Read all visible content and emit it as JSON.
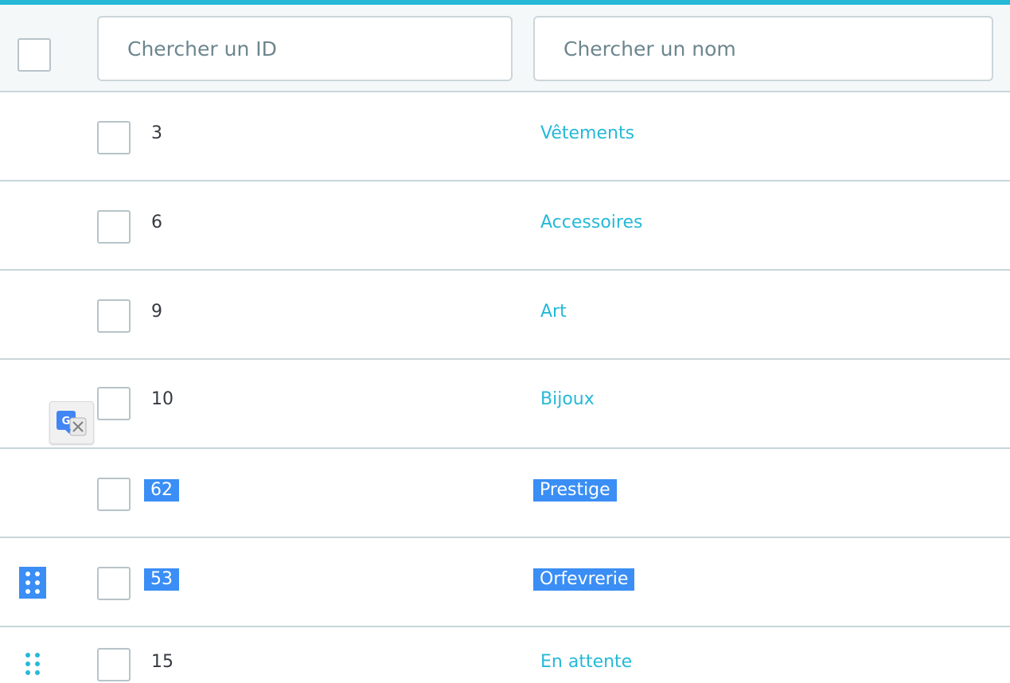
{
  "filters": {
    "id_placeholder": "Chercher un ID",
    "name_placeholder": "Chercher un nom"
  },
  "rows": [
    {
      "id": "3",
      "name": "Vêtements"
    },
    {
      "id": "6",
      "name": "Accessoires"
    },
    {
      "id": "9",
      "name": "Art"
    },
    {
      "id": "10",
      "name": "Bijoux"
    },
    {
      "id": "62",
      "name": "Prestige"
    },
    {
      "id": "53",
      "name": "Orfevrerie"
    },
    {
      "id": "15",
      "name": "En attente"
    }
  ],
  "colors": {
    "accent": "#25b9d7",
    "selection": "#3a8ef5",
    "text": "#363a41"
  },
  "icons": {
    "drag": "drag-handle-icon",
    "translate": "google-translate-icon"
  }
}
